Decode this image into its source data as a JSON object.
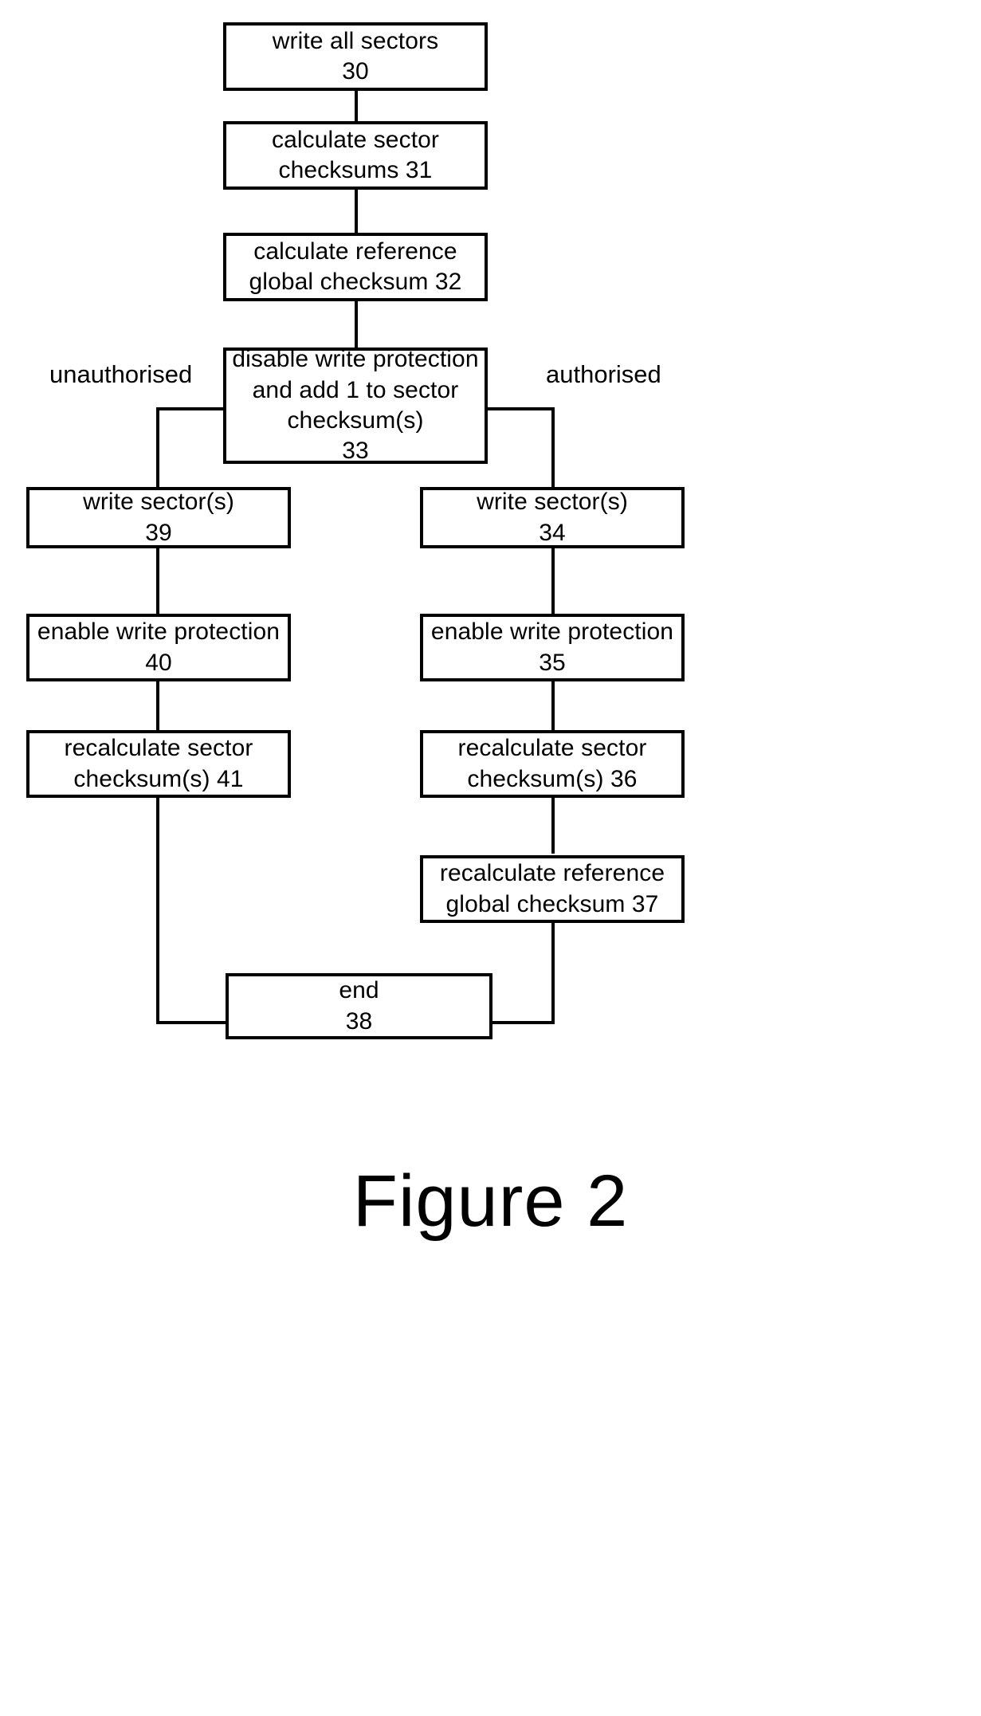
{
  "figure": {
    "caption": "Figure 2",
    "type": "flowchart"
  },
  "chart_data": {
    "type": "diagram",
    "title": "Figure 2",
    "nodes": [
      {
        "id": "30",
        "label": "write all sectors",
        "ref": "30",
        "lines": [
          "write all sectors",
          "30"
        ]
      },
      {
        "id": "31",
        "label": "calculate sector checksums 31",
        "ref": "31",
        "lines": [
          "calculate sector",
          "checksums 31"
        ]
      },
      {
        "id": "32",
        "label": "calculate reference global checksum 32",
        "ref": "32",
        "lines": [
          "calculate reference",
          "global checksum 32"
        ]
      },
      {
        "id": "33",
        "label": "disable write protection and add 1 to sector checksum(s) 33",
        "ref": "33",
        "lines": [
          "disable write protection",
          "and add 1 to sector",
          "checksum(s)",
          "33"
        ]
      },
      {
        "id": "39",
        "label": "write sector(s) 39",
        "ref": "39",
        "lines": [
          "write sector(s)",
          "39"
        ]
      },
      {
        "id": "34",
        "label": "write sector(s) 34",
        "ref": "34",
        "lines": [
          "write sector(s)",
          "34"
        ]
      },
      {
        "id": "40",
        "label": "enable write protection 40",
        "ref": "40",
        "lines": [
          "enable write protection",
          "40"
        ]
      },
      {
        "id": "35",
        "label": "enable write protection 35",
        "ref": "35",
        "lines": [
          "enable write protection",
          "35"
        ]
      },
      {
        "id": "41",
        "label": "recalculate sector checksum(s) 41",
        "ref": "41",
        "lines": [
          "recalculate sector",
          "checksum(s) 41"
        ]
      },
      {
        "id": "36",
        "label": "recalculate sector checksum(s) 36",
        "ref": "36",
        "lines": [
          "recalculate sector",
          "checksum(s) 36"
        ]
      },
      {
        "id": "37",
        "label": "recalculate reference global checksum 37",
        "ref": "37",
        "lines": [
          "recalculate reference",
          "global checksum 37"
        ]
      },
      {
        "id": "38",
        "label": "end 38",
        "ref": "38",
        "lines": [
          "end",
          "38"
        ]
      }
    ],
    "edge_labels": [
      {
        "id": "unauthorised",
        "text": "unauthorised",
        "side": "left"
      },
      {
        "id": "authorised",
        "text": "authorised",
        "side": "right"
      }
    ],
    "edges": [
      {
        "from": "30",
        "to": "31"
      },
      {
        "from": "31",
        "to": "32"
      },
      {
        "from": "32",
        "to": "33"
      },
      {
        "from": "33",
        "to": "39",
        "label": "unauthorised"
      },
      {
        "from": "33",
        "to": "34",
        "label": "authorised"
      },
      {
        "from": "39",
        "to": "40"
      },
      {
        "from": "40",
        "to": "41"
      },
      {
        "from": "41",
        "to": "38"
      },
      {
        "from": "34",
        "to": "35"
      },
      {
        "from": "35",
        "to": "36"
      },
      {
        "from": "36",
        "to": "37"
      },
      {
        "from": "37",
        "to": "38"
      }
    ],
    "colors": {
      "stroke": "#000000",
      "fill": "#ffffff",
      "text": "#000000"
    }
  },
  "nodes": {
    "n30": {
      "l1": "write all sectors",
      "l2": "30"
    },
    "n31": {
      "l1": "calculate sector",
      "l2": "checksums 31"
    },
    "n32": {
      "l1": "calculate reference",
      "l2": "global checksum 32"
    },
    "n33": {
      "l1": "disable write protection",
      "l2": "and add 1 to sector",
      "l3": "checksum(s)",
      "l4": "33"
    },
    "n39": {
      "l1": "write sector(s)",
      "l2": "39"
    },
    "n34": {
      "l1": "write sector(s)",
      "l2": "34"
    },
    "n40": {
      "l1": "enable write protection",
      "l2": "40"
    },
    "n35": {
      "l1": "enable write protection",
      "l2": "35"
    },
    "n41": {
      "l1": "recalculate sector",
      "l2": "checksum(s) 41"
    },
    "n36": {
      "l1": "recalculate sector",
      "l2": "checksum(s) 36"
    },
    "n37": {
      "l1": "recalculate reference",
      "l2": "global checksum 37"
    },
    "n38": {
      "l1": "end",
      "l2": "38"
    }
  },
  "labels": {
    "unauthorised": "unauthorised",
    "authorised": "authorised"
  }
}
